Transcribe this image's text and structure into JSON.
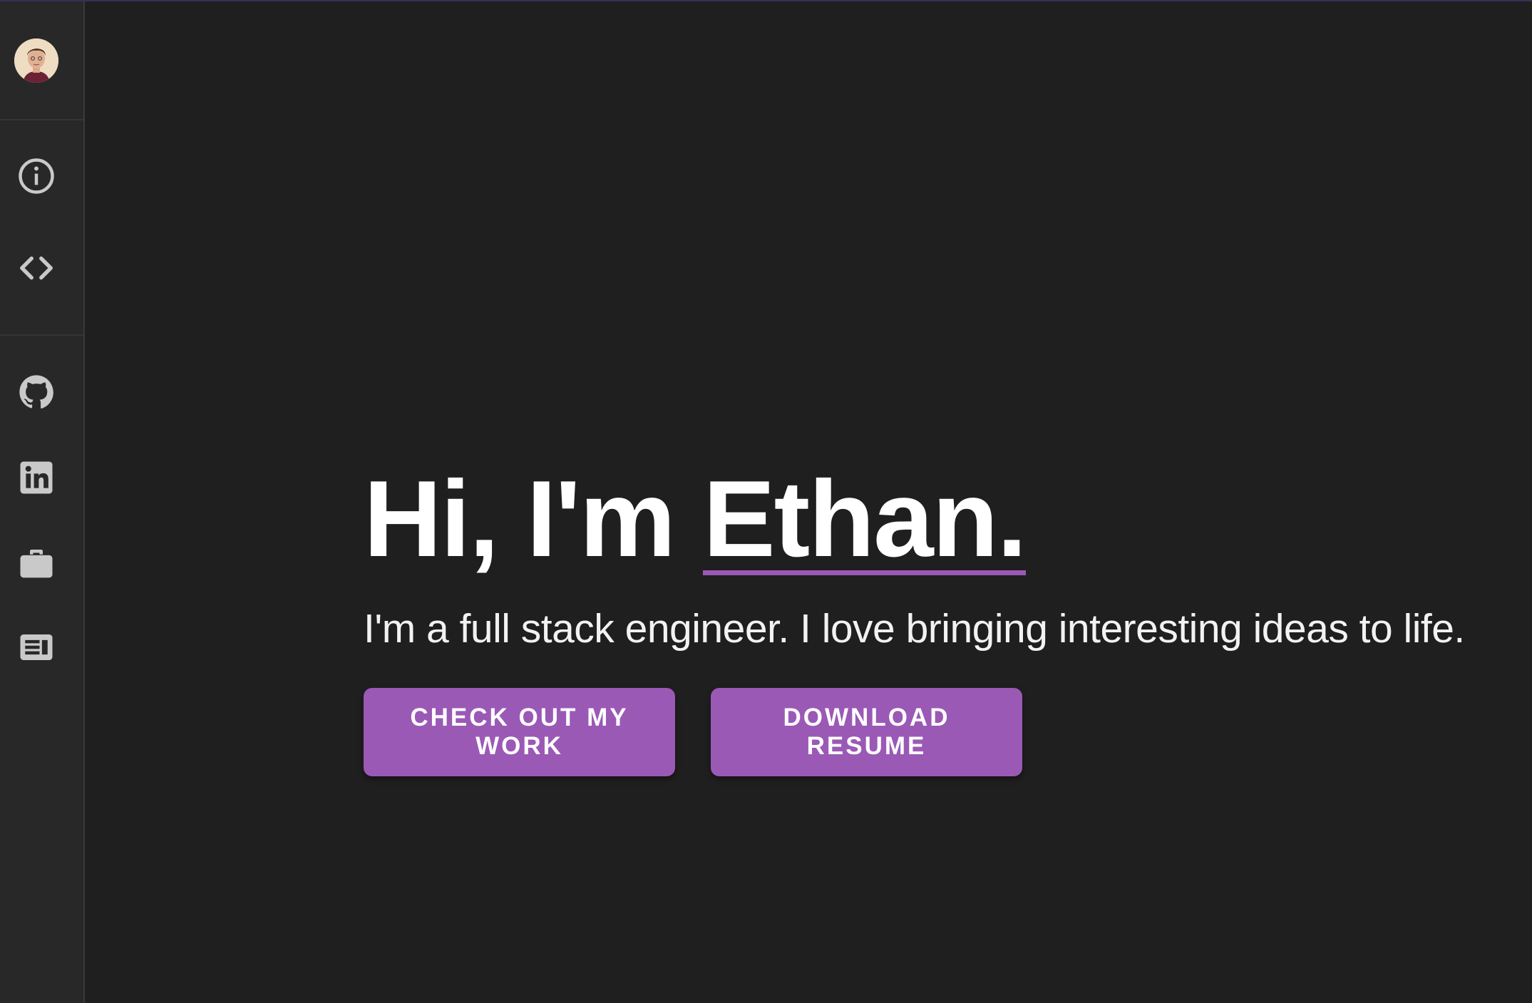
{
  "sidebar": {
    "avatar_icon": "profile-avatar",
    "nav": [
      {
        "name": "about",
        "icon": "info-circle-icon"
      },
      {
        "name": "projects",
        "icon": "code-brackets-icon"
      }
    ],
    "social": [
      {
        "name": "github",
        "icon": "github-icon"
      },
      {
        "name": "linkedin",
        "icon": "linkedin-icon"
      },
      {
        "name": "portfolio",
        "icon": "briefcase-icon"
      },
      {
        "name": "blog",
        "icon": "article-icon"
      }
    ],
    "icon_color": "#c9c9c9"
  },
  "hero": {
    "greeting": "Hi, I'm ",
    "name": "Ethan.",
    "subtitle": "I'm a full stack engineer. I love bringing interesting ideas to life."
  },
  "buttons": {
    "work_label": "CHECK OUT MY WORK",
    "resume_label": "DOWNLOAD RESUME"
  },
  "colors": {
    "accent": "#9b59b6",
    "background": "#1f1f1f",
    "sidebar": "#282828"
  }
}
